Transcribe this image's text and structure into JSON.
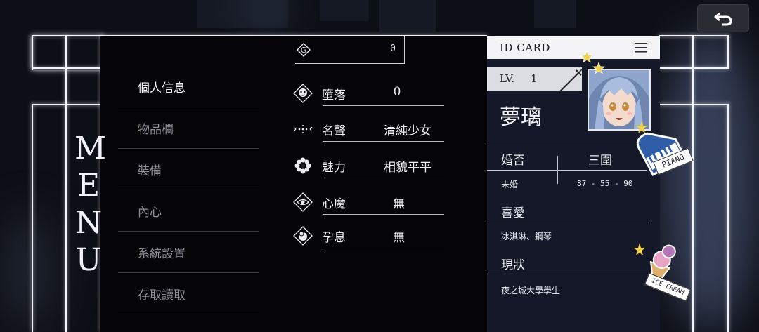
{
  "gold": {
    "value": "0"
  },
  "menu_letters": [
    "M",
    "E",
    "N",
    "U"
  ],
  "sidebar": {
    "items": [
      {
        "label": "個人信息",
        "active": true
      },
      {
        "label": "物品欄",
        "active": false
      },
      {
        "label": "裝備",
        "active": false
      },
      {
        "label": "內心",
        "active": false
      },
      {
        "label": "系統設置",
        "active": false
      },
      {
        "label": "存取讀取",
        "active": false
      }
    ]
  },
  "stats": [
    {
      "icon": "fallen-face-icon",
      "label": "墮落",
      "value": "0"
    },
    {
      "icon": "dots-icon",
      "label": "名聲",
      "value": "清純少女"
    },
    {
      "icon": "flower-icon",
      "label": "魅力",
      "value": "相貌平平"
    },
    {
      "icon": "eye-icon",
      "label": "心魔",
      "value": "無"
    },
    {
      "icon": "egg-icon",
      "label": "孕息",
      "value": "無"
    }
  ],
  "idcard": {
    "title": "ID CARD",
    "level_label": "LV.",
    "level_value": "1",
    "name": "夢璃",
    "marriage_label": "婚否",
    "marriage_value": "未婚",
    "measure_label": "三圍",
    "measure_value": "87 - 55 - 90",
    "hobby_label": "喜愛",
    "hobby_value": "冰淇淋、鋼琴",
    "status_label": "現狀",
    "status_value": "夜之城大學學生",
    "sticker_piano": "PIANO",
    "sticker_icecream": "ICE CREAM"
  },
  "colors": {
    "accent": "#f4f4ff",
    "panel": "#050507",
    "card": "#141828",
    "star": "#f2d24a"
  }
}
